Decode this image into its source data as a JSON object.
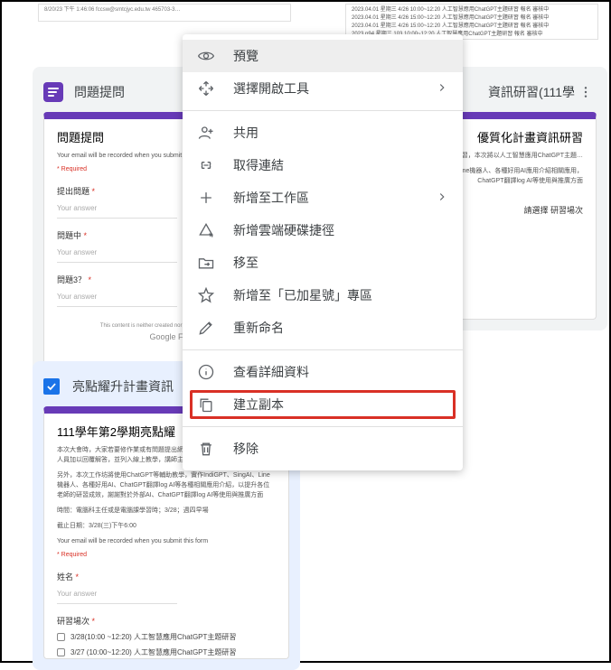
{
  "top_thumbs": {
    "left_text": "8/20/23 下午 1:46:06 fccsw@smtcjyc.edu.tw  465703-3…",
    "right_rows": [
      "2023.04.01 星期三  4/26 10:00~12:20 人工智慧應用ChatGPT主題研習   報名  審核中",
      "2023.04.01 星期三  4/26 15:00~12:20 人工智慧應用ChatGPT主題研習   報名  審核中",
      "2023.04.01 星期三  4/26 15:00~12:20 人工智慧應用ChatGPT主題研習   報名  審核中",
      "2023.p94 星期三  103 10:00~12:20 人工智慧應用ChatGPT主題研習   報名  審核中"
    ]
  },
  "card1": {
    "title": "問題提問",
    "form_title": "問題提問",
    "desc": "Your email will be recorded when you submit this form",
    "required": "* Required",
    "fields": [
      {
        "label": "提出問題",
        "answer": "Your answer"
      },
      {
        "label": "問題中",
        "answer": "Your answer"
      },
      {
        "label": "問題3？",
        "answer": "Your answer"
      }
    ],
    "footer_note": "This content is neither created nor endorsed by Google",
    "brand": "Google F"
  },
  "card2": {
    "title": "亮點耀升計畫資訊",
    "form_title": "111學年第2學期亮點耀",
    "desc1": "本次大會時，大家若要修作業或有問題提出網路問題，即可詳情，將由主任或人員加以回覆解答，並列入線上教學，講師主講大家的討論分享等",
    "desc2": "另外，本次工作坊將使用ChatGPT等輔助教學，實作IndiGPT、SingAI、Line機器人、各種好用AI、ChatGPT翻譯log AI等各種相關應用介紹，以提升各位老師的研習成效，謝謝對於外部AI、ChatGPT翻譯log AI等使用與推廣方面",
    "desc3": "時間：電腦科主任或是電腦課學習時；3/28；週四早場",
    "desc4": "截止日期：3/28(三)下午6:00",
    "email_note": "Your email will be recorded when you submit this form",
    "required": "* Required",
    "field_name": {
      "label": "姓名",
      "answer": "Your answer"
    },
    "field_session": "研習場次",
    "opt1": "3/28(10:00 ~12:20) 人工智慧應用ChatGPT主題研習",
    "opt2": "3/27 (10:00~12:20) 人工智慧應用ChatGPT主題研習"
  },
  "right_card": {
    "title": "資訊研習(111學",
    "form_title": "優質化計畫資訊研習",
    "desc": "歡迎參加計畫所安排的資訊研習，本次將以人工智慧應用ChatGPT主題…",
    "desc2": "實作IndiGPT、SingAI、Line機器人、各種好用AI應用介紹相關應用，ChatGPT翻譯log AI等使用與推廣方面",
    "field": "請選擇 研習場次"
  },
  "menu": {
    "items": [
      {
        "key": "preview",
        "label": "預覽",
        "icon": "eye",
        "hovered": true
      },
      {
        "key": "openwith",
        "label": "選擇開啟工具",
        "icon": "open-with",
        "submenu": true
      },
      {
        "divider": true
      },
      {
        "key": "share",
        "label": "共用",
        "icon": "person-add"
      },
      {
        "key": "getlink",
        "label": "取得連結",
        "icon": "link"
      },
      {
        "key": "addtoworkspace",
        "label": "新增至工作區",
        "icon": "plus",
        "submenu": true
      },
      {
        "key": "adddriveshortcut",
        "label": "新增雲端硬碟捷徑",
        "icon": "drive-shortcut"
      },
      {
        "key": "moveto",
        "label": "移至",
        "icon": "folder-move"
      },
      {
        "key": "addtostarred",
        "label": "新增至「已加星號」專區",
        "icon": "star"
      },
      {
        "key": "rename",
        "label": "重新命名",
        "icon": "pencil"
      },
      {
        "divider": true
      },
      {
        "key": "details",
        "label": "查看詳細資料",
        "icon": "info"
      },
      {
        "key": "makecopy",
        "label": "建立副本",
        "icon": "copy",
        "highlighted": true
      },
      {
        "divider": true
      },
      {
        "key": "remove",
        "label": "移除",
        "icon": "trash"
      }
    ]
  }
}
